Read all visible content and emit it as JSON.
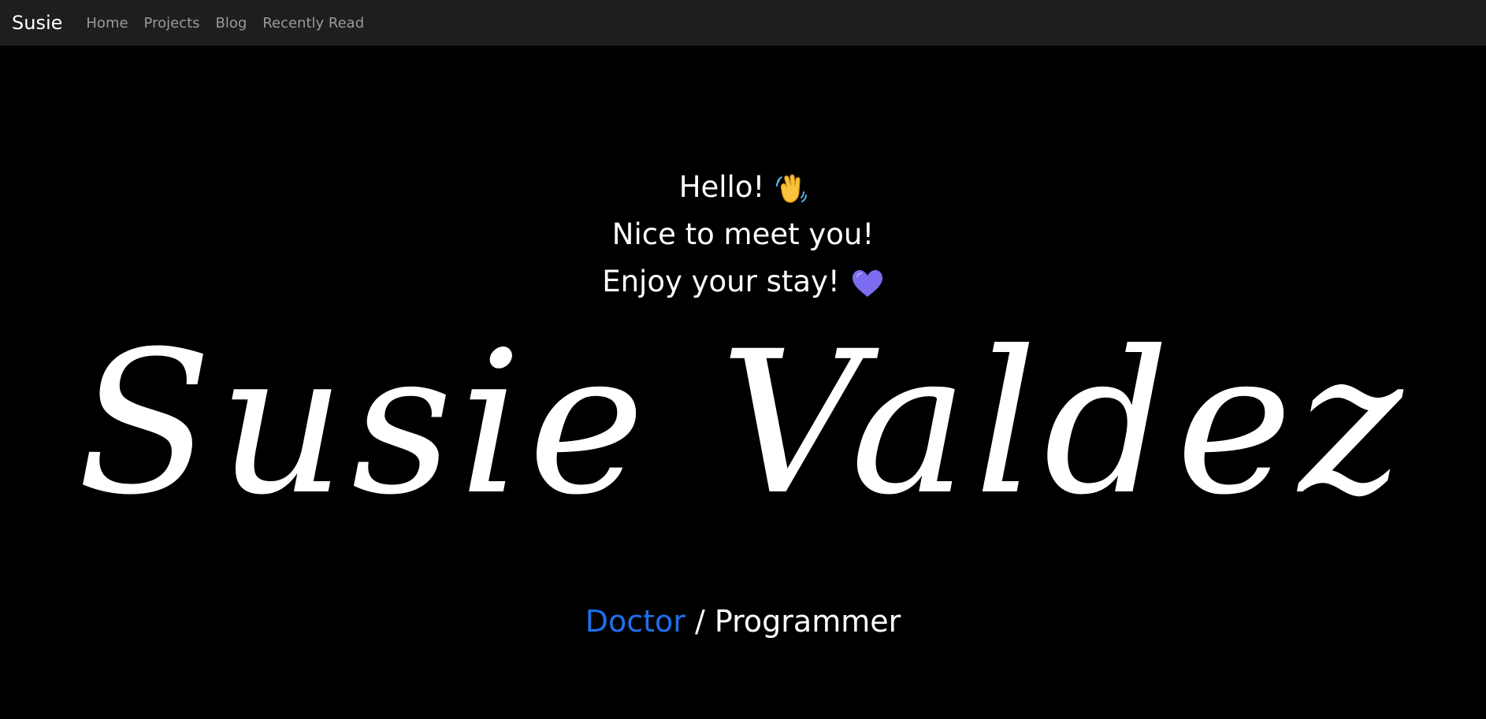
{
  "navbar": {
    "brand": "Susie",
    "links": [
      "Home",
      "Projects",
      "Blog",
      "Recently Read"
    ]
  },
  "hero": {
    "greeting_1": "Hello!",
    "greeting_1_emoji": "waving-hand-icon",
    "greeting_2": "Nice to meet you!",
    "greeting_3": "Enjoy your stay!",
    "greeting_3_emoji": "purple-heart-icon",
    "name": "Susie Valdez",
    "role_primary": "Doctor",
    "role_separator": " / ",
    "role_secondary": "Programmer"
  },
  "colors": {
    "navbar_bg": "#1e1e1e",
    "page_bg": "#000000",
    "text": "#ffffff",
    "nav_link": "#9a9a9a",
    "accent": "#1f6feb",
    "heart": "#7b6cf0"
  }
}
